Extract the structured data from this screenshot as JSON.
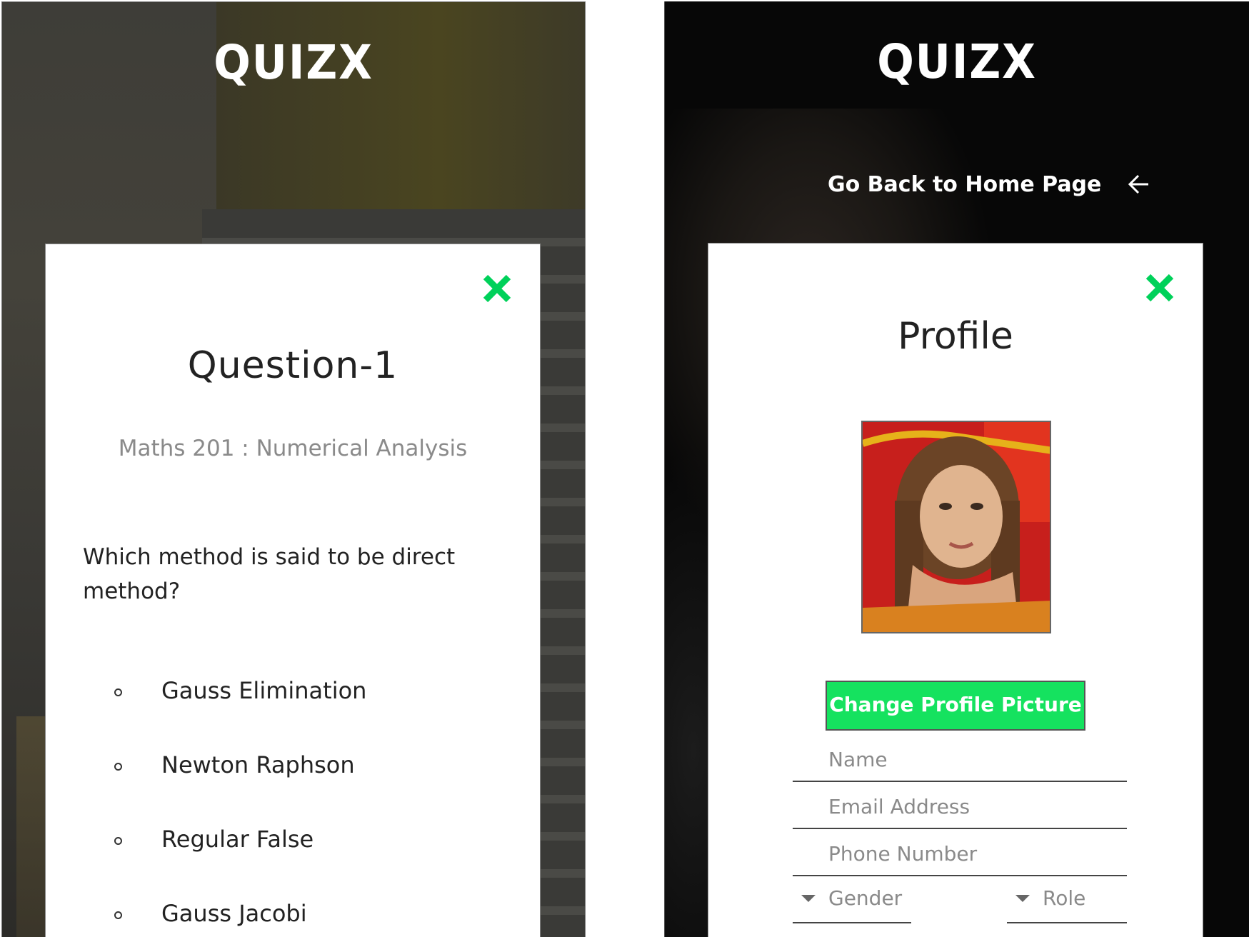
{
  "left_screen": {
    "logo": "QUIZX",
    "question_card": {
      "title": "Question-1",
      "subject": "Maths 201 : Numerical Analysis",
      "question": "Which method is said to be direct method?",
      "options": [
        "Gauss Elimination",
        "Newton Raphson",
        "Regular False",
        "Gauss Jacobi"
      ],
      "close_icon": "close-icon"
    }
  },
  "right_screen": {
    "logo": "QUIZX",
    "nav_back_label": "Go Back to Home Page",
    "arrow_icon": "arrow-left-icon",
    "profile_card": {
      "title": "Profile",
      "change_picture_label": "Change Profile Picture",
      "fields": {
        "name_placeholder": "Name",
        "email_placeholder": "Email Address",
        "phone_placeholder": "Phone Number"
      },
      "gender_label": "Gender",
      "role_label": "Role",
      "close_icon": "close-icon"
    }
  },
  "colors": {
    "accent": "#15e25f",
    "close": "#00d15a",
    "card": "#ffffff",
    "text": "#222222",
    "muted": "#8a8a8a"
  }
}
